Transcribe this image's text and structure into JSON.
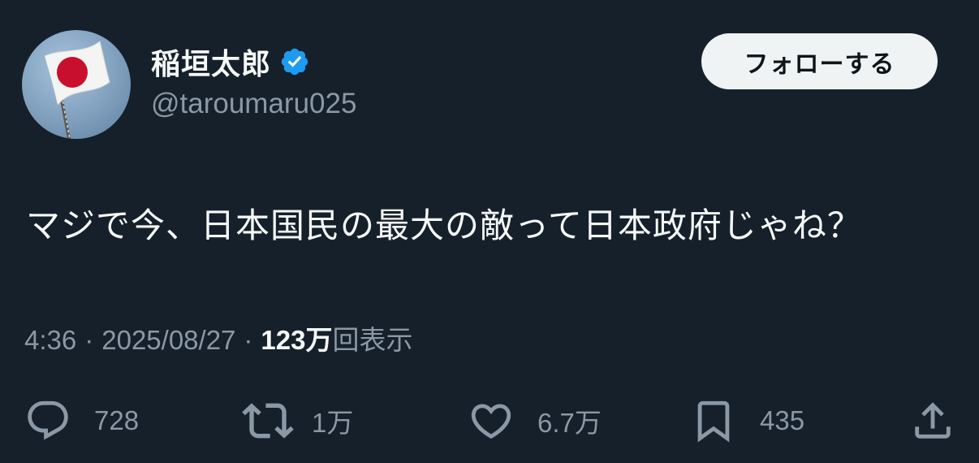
{
  "user": {
    "display_name": "稲垣太郎",
    "handle": "@taroumaru025",
    "verified": true,
    "verified_color": "#1d9bf0",
    "avatar_icon": "japan-flag-avatar"
  },
  "follow_button": {
    "label": "フォローする"
  },
  "tweet": {
    "text": "マジで今、日本国民の最大の敵って日本政府じゃね？"
  },
  "meta": {
    "time": "4:36",
    "date": "2025/08/27",
    "separator": "·",
    "views_count": "123万",
    "views_label": "回表示"
  },
  "actions": {
    "reply": {
      "icon": "reply-icon",
      "count": "728"
    },
    "retweet": {
      "icon": "retweet-icon",
      "count": "1万"
    },
    "like": {
      "icon": "heart-icon",
      "count": "6.7万"
    },
    "bookmark": {
      "icon": "bookmark-icon",
      "count": "435"
    },
    "share": {
      "icon": "share-icon"
    }
  },
  "colors": {
    "background": "#15202b",
    "text_primary": "#f7f9f9",
    "text_secondary": "#8b98a5",
    "button_bg": "#eff3f4"
  }
}
